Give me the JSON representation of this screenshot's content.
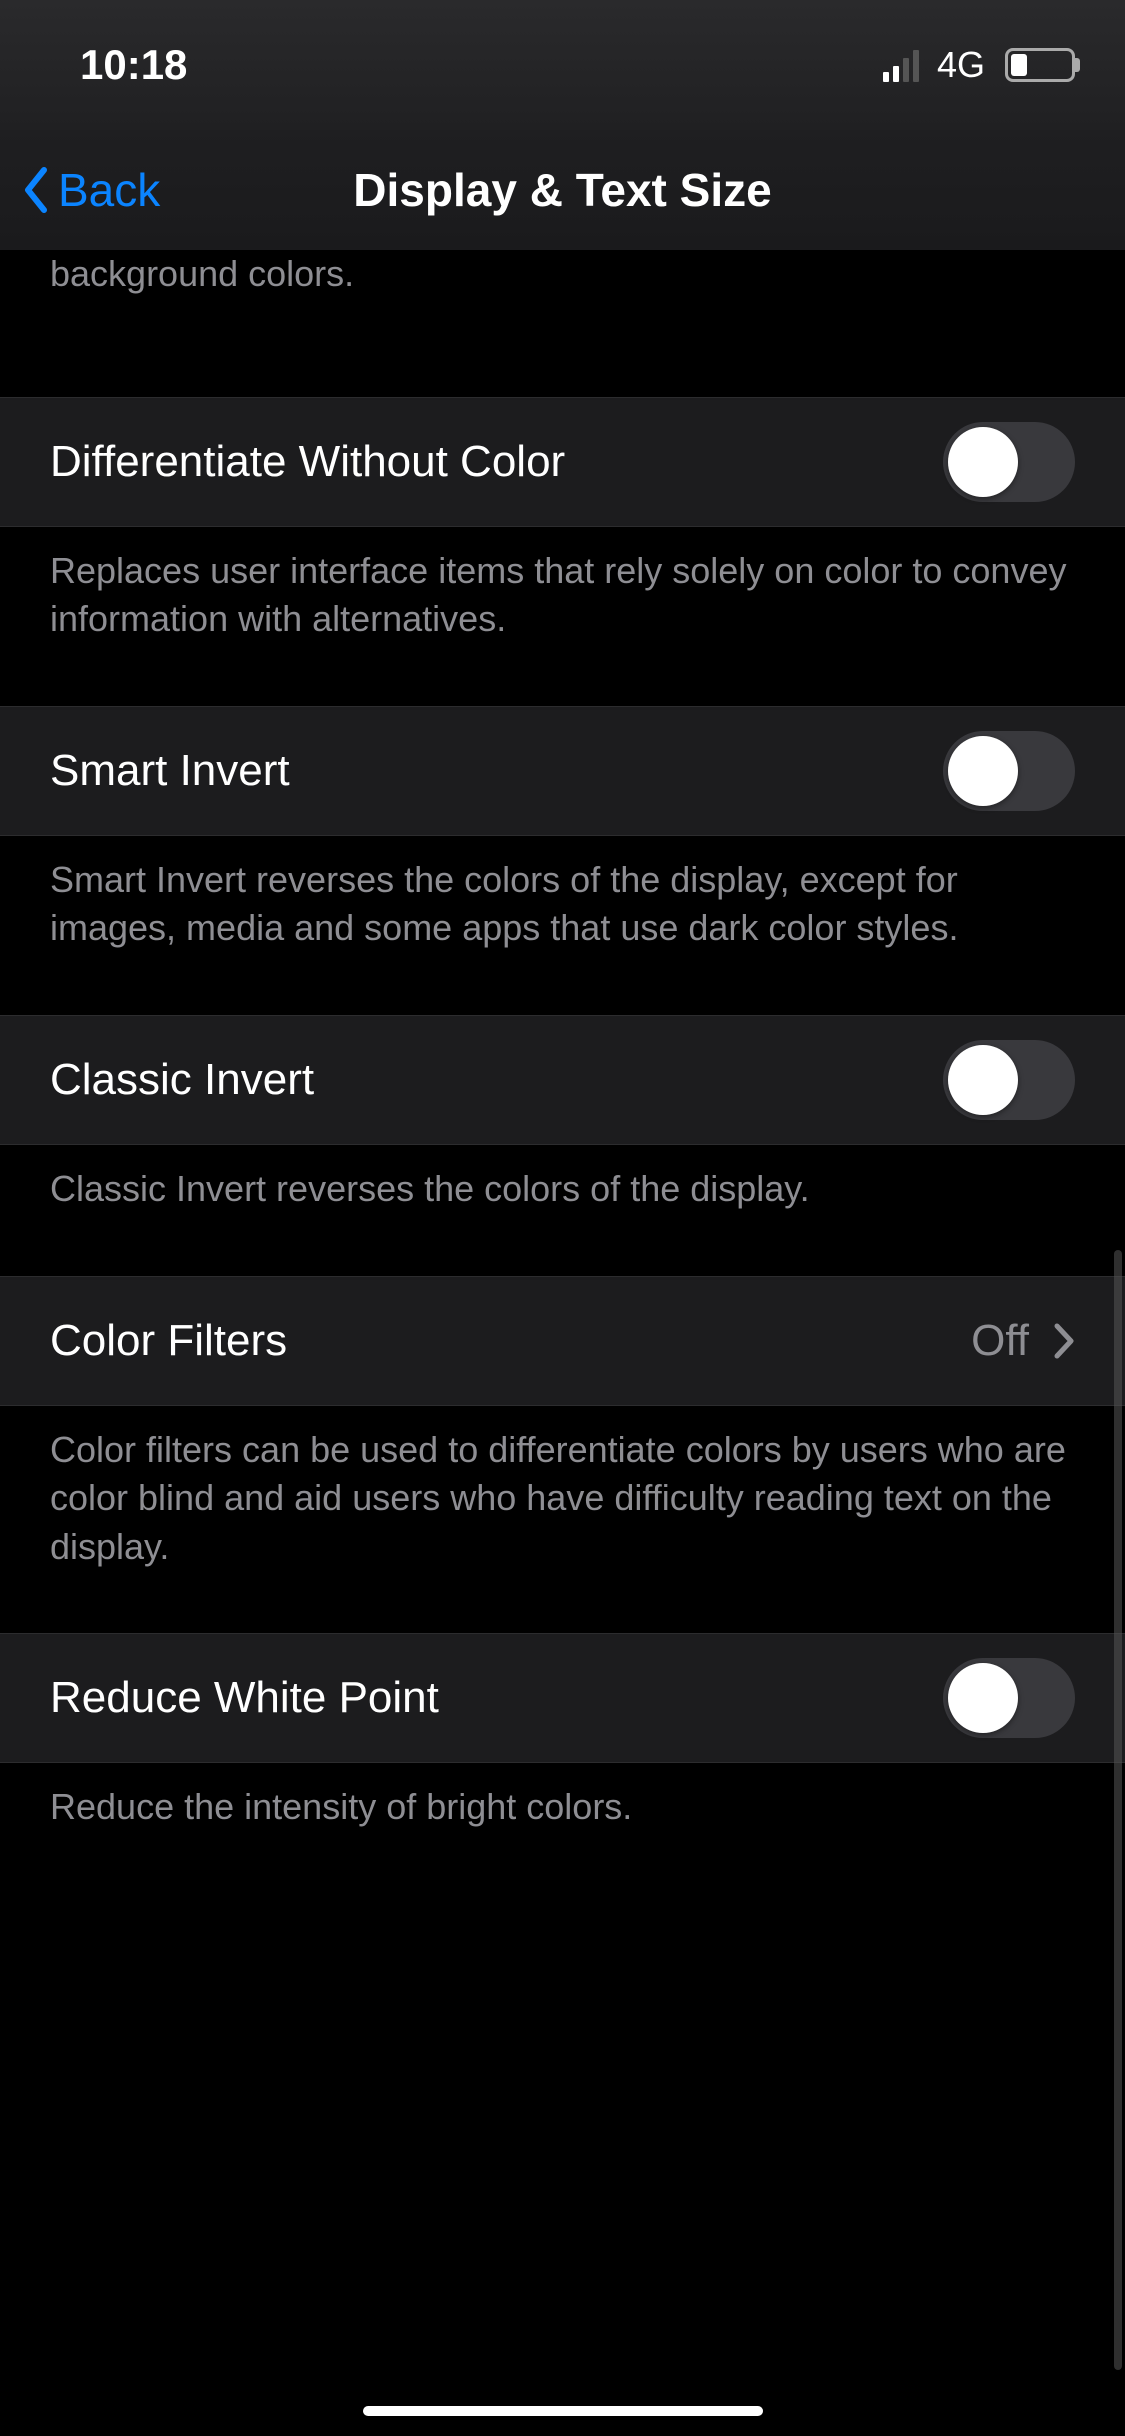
{
  "statusBar": {
    "time": "10:18",
    "network": "4G"
  },
  "nav": {
    "back": "Back",
    "title": "Display & Text Size"
  },
  "partialFooter": "background colors.",
  "sections": [
    {
      "label": "Differentiate Without Color",
      "footer": "Replaces user interface items that rely solely on color to convey information with alternatives.",
      "type": "toggle",
      "value": false
    },
    {
      "label": "Smart Invert",
      "footer": "Smart Invert reverses the colors of the display, except for images, media and some apps that use dark color styles.",
      "type": "toggle",
      "value": false
    },
    {
      "label": "Classic Invert",
      "footer": "Classic Invert reverses the colors of the display.",
      "type": "toggle",
      "value": false
    },
    {
      "label": "Color Filters",
      "footer": "Color filters can be used to differentiate colors by users who are color blind and aid users who have difficulty reading text on the display.",
      "type": "disclosure",
      "value": "Off"
    },
    {
      "label": "Reduce White Point",
      "footer": "Reduce the intensity of bright colors.",
      "type": "toggle",
      "value": false
    }
  ]
}
